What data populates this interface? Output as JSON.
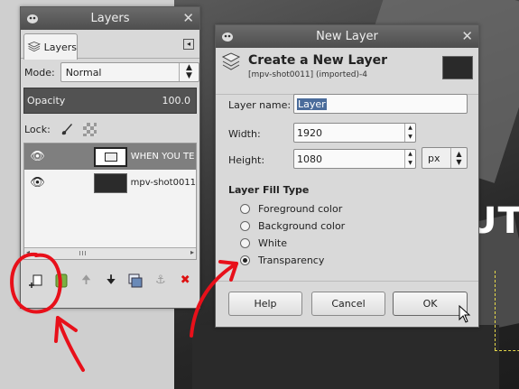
{
  "layers_dock": {
    "title": "Layers",
    "tab_label": "Layers",
    "mode_label": "Mode:",
    "mode_value": "Normal",
    "opacity_label": "Opacity",
    "opacity_value": "100.0",
    "lock_label": "Lock:",
    "layers": [
      {
        "name": "WHEN YOU TE",
        "visible": true,
        "selected": true
      },
      {
        "name": "mpv-shot0011.",
        "visible": true,
        "selected": false
      }
    ],
    "buttons": [
      "new-layer-icon",
      "layer-group-icon",
      "raise-layer-icon",
      "lower-layer-icon",
      "duplicate-layer-icon",
      "anchor-icon",
      "delete-layer-icon"
    ]
  },
  "new_layer_dialog": {
    "window_title": "New Layer",
    "header_title": "Create a New Layer",
    "header_subtitle": "[mpv-shot0011] (imported)-4",
    "layer_name_label": "Layer name:",
    "layer_name_value": "Layer",
    "width_label": "Width:",
    "width_value": "1920",
    "height_label": "Height:",
    "height_value": "1080",
    "unit_value": "px",
    "fill_type_title": "Layer Fill Type",
    "fill_options": [
      {
        "label": "Foreground color",
        "checked": false
      },
      {
        "label": "Background color",
        "checked": false
      },
      {
        "label": "White",
        "checked": false
      },
      {
        "label": "Transparency",
        "checked": true
      }
    ],
    "help_label": "Help",
    "cancel_label": "Cancel",
    "ok_label": "OK"
  },
  "canvas": {
    "visible_text": "UT"
  },
  "colors": {
    "annotation_red": "#e8101a",
    "selection_dash": "#e6d94a",
    "selected_row": "#7f7f7f",
    "titlebar": "#555555"
  }
}
